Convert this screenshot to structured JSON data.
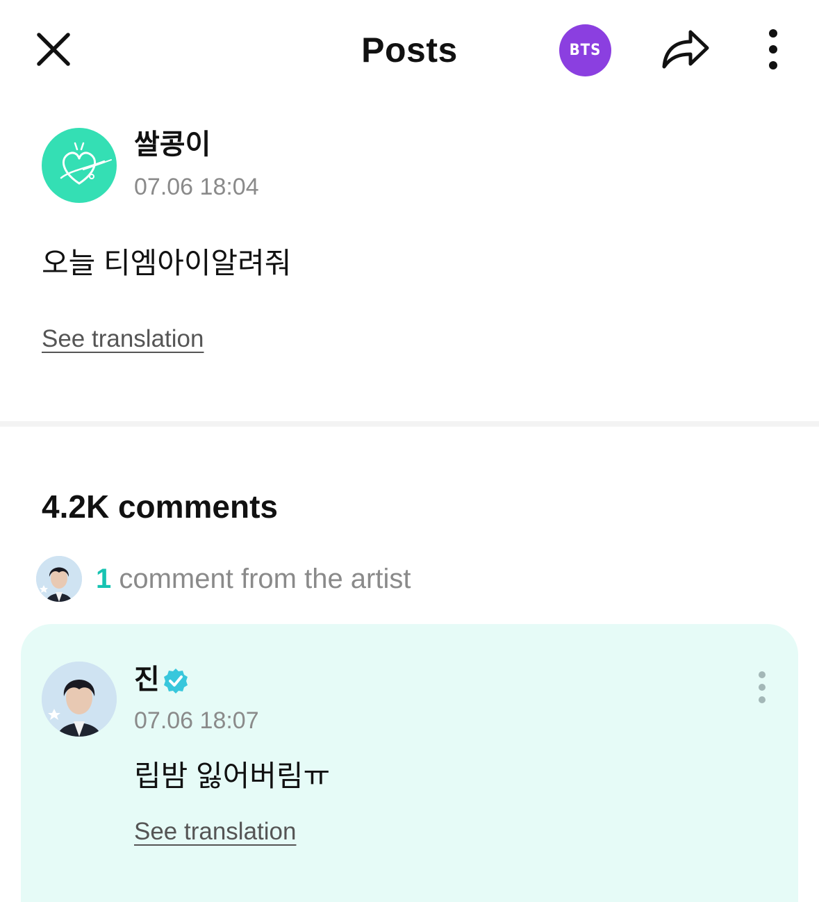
{
  "header": {
    "title": "Posts",
    "community_badge": "BTS",
    "icons": [
      "close-icon",
      "share-icon",
      "more-vertical-icon"
    ]
  },
  "post": {
    "author": "쌀콩이",
    "timestamp": "07.06 18:04",
    "body": "오늘 티엠아이알려줘",
    "translate_label": "See translation"
  },
  "comments": {
    "count_label": "4.2K comments",
    "artist_count": "1",
    "artist_label": " comment from the artist",
    "artist_comment": {
      "author": "진",
      "verified": true,
      "timestamp": "07.06 18:07",
      "body": "립밤 잃어버림ㅠ",
      "translate_label": "See translation"
    }
  },
  "colors": {
    "accent": "#17c3b2",
    "badge": "#8b3fe0",
    "card_bg": "#e6fbf7",
    "avatar_bg": "#34dfb4",
    "verified": "#38c7dc"
  }
}
